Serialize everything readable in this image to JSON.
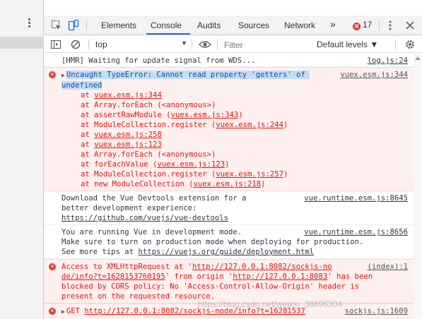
{
  "tabs": [
    "Elements",
    "Console",
    "Audits",
    "Sources",
    "Network"
  ],
  "more_tabs": "»",
  "error_count": "17",
  "toolbar": {
    "context": "top",
    "filter_placeholder": "Filter",
    "levels": "Default levels ▼"
  },
  "messages": {
    "hmr": {
      "text": "[HMR] Waiting for update signal from WDS...",
      "src": "log.js:24"
    },
    "err1": {
      "text_a": "Uncaught TypeError: Cannot read property 'getters' of ",
      "text_b": "undefined",
      "src": "vuex.esm.js:344",
      "stack": [
        {
          "pre": "at ",
          "fn": "",
          "loc": "vuex.esm.js:344",
          "post": ""
        },
        {
          "pre": "at Array.forEach (<anonymous>)",
          "fn": "",
          "loc": "",
          "post": ""
        },
        {
          "pre": "at assertRawModule (",
          "fn": "",
          "loc": "vuex.esm.js:343",
          "post": ")"
        },
        {
          "pre": "at ModuleCollection.register (",
          "fn": "",
          "loc": "vuex.esm.js:244",
          "post": ")"
        },
        {
          "pre": "at ",
          "fn": "",
          "loc": "vuex.esm.js:258",
          "post": ""
        },
        {
          "pre": "at ",
          "fn": "",
          "loc": "vuex.esm.js:123",
          "post": ""
        },
        {
          "pre": "at Array.forEach (<anonymous>)",
          "fn": "",
          "loc": "",
          "post": ""
        },
        {
          "pre": "at forEachValue (",
          "fn": "",
          "loc": "vuex.esm.js:123",
          "post": ")"
        },
        {
          "pre": "at ModuleCollection.register (",
          "fn": "",
          "loc": "vuex.esm.js:257",
          "post": ")"
        },
        {
          "pre": "at new ModuleCollection (",
          "fn": "",
          "loc": "vuex.esm.js:218",
          "post": ")"
        }
      ]
    },
    "devtools": {
      "line1": "Download the Vue Devtools extension for a",
      "line2": "better development experience:",
      "link": "https://github.com/vuejs/vue-devtools",
      "src": "vue.runtime.esm.js:8645"
    },
    "prodtip": {
      "line1": "You are running Vue in development mode.",
      "line2": "Make sure to turn on production mode when deploying for production.",
      "line3_pre": "See more tips at ",
      "link": "https://vuejs.org/guide/deployment.html",
      "src": "vue.runtime.esm.js:8656"
    },
    "cors": {
      "l1_pre": "Access to XMLHttpRequest at '",
      "l1_link": "http://127.0.0.1:8082/sockjs-no",
      "src": "(index):1",
      "l2_link": "de/info?t=1628153760195",
      "l2_mid": "' from origin '",
      "l2_link2": "http://127.0.0.1:8083",
      "l2_post": "' has been",
      "l3": "blocked by CORS policy: No 'Access-Control-Allow-Origin' header is",
      "l4": "present on the requested resource."
    },
    "get": {
      "pre": "GET ",
      "link": "http://127.0.0.1:8082/sockjs-node/info?t=16281537",
      "src": "sockjs.js:1609"
    }
  },
  "watermark": "https://blog.csdn.net/weixin_38696304"
}
